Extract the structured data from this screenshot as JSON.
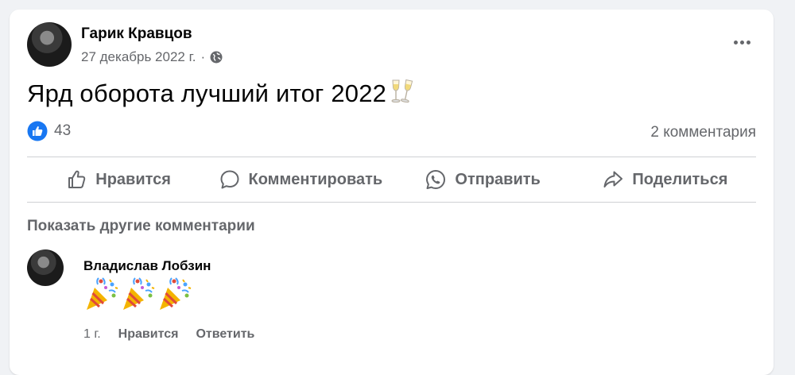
{
  "post": {
    "author": "Гарик Кравцов",
    "date": "27 декабрь 2022 г.",
    "separator": "·",
    "text": "Ярд оборота лучший итог 2022",
    "emoji": "champagne-glasses-icon",
    "likes": "43",
    "comments_count": "2 комментария"
  },
  "actions": {
    "like": "Нравится",
    "comment": "Комментировать",
    "send": "Отправить",
    "share": "Поделиться"
  },
  "comments_section": {
    "show_more": "Показать другие комментарии"
  },
  "comment": {
    "author": "Владислав Лобзин",
    "emojis": [
      "party-popper-icon",
      "party-popper-icon",
      "party-popper-icon"
    ],
    "time": "1 г.",
    "like": "Нравится",
    "reply": "Ответить"
  },
  "colors": {
    "like_blue": "#1877f2",
    "secondary_text": "#65676b",
    "background": "#f0f2f5"
  }
}
